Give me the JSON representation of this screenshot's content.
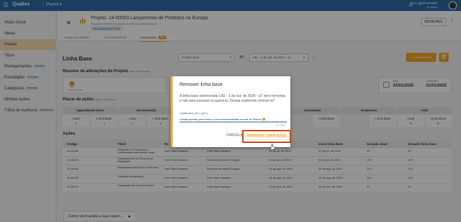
{
  "topbar": {
    "logo": "Qualiex",
    "app": "Planos",
    "user_name": "Davi | Administrador",
    "user_org": "FL EDU"
  },
  "sidebar": {
    "items": [
      {
        "label": "Visão Geral",
        "badge": ""
      },
      {
        "label": "Ideias",
        "badge": ""
      },
      {
        "label": "Planos",
        "badge": ""
      },
      {
        "label": "Tipos",
        "badge": ""
      },
      {
        "label": "Planejamentos",
        "badge": "Extensão"
      },
      {
        "label": "Estratégias",
        "badge": "Extensão"
      },
      {
        "label": "Categorias",
        "badge": "Extensão"
      },
      {
        "label": "Minhas Ações",
        "badge": ""
      },
      {
        "label": "Trilha de Auditoria",
        "badge": "Simplificada"
      }
    ]
  },
  "project": {
    "title": "Projeto: 24-00003 Lançamento de Produtos na Europa",
    "subtitle": "Programa: 00009 Expansão de Mercado Internacional",
    "status": "Em Andamento (70%)",
    "tabs": [
      "PLANO DE AÇÕES",
      "STATUS REPORT",
      "LINHA BASE",
      "Beta"
    ],
    "details_label": "DETALHES"
  },
  "linha_base": {
    "title": "Linha Base",
    "project_select": "Projeto atual",
    "lb_select": "LB2 - 1 de out. de 2024 - v2",
    "add_button": "+ LINHA BASE",
    "resumo_title": "Resumo de alterações do Projeto",
    "resumo_note": "(atual X linha base)",
    "card_value": "0",
    "card_label": "Ações novas",
    "atual_label": "Atual",
    "atual_date": "31/01/2025",
    "lb_label": "Linha Base",
    "lb_date": "31/01/2025"
  },
  "placar": {
    "title": "Placar de ações",
    "note": "(atual X linha base)",
    "columns": [
      {
        "name": "Aguardando início",
        "atual": "1",
        "linha_base": "1"
      },
      {
        "name": "Em execução",
        "atual": "1",
        "linha_base": "1"
      },
      {
        "name": "Canceladas",
        "atual": "",
        "linha_base": "Linha Base"
      },
      {
        "name": "Suspensas",
        "atual": "",
        "linha_base": "Linha Base"
      },
      {
        "name": "Total",
        "atual": "5",
        "linha_base": "5"
      }
    ],
    "sub_atual": "Atual",
    "sub_lb": "Linha Base"
  },
  "acoes": {
    "title": "Ações",
    "headers": [
      "Código",
      "Título",
      "Re",
      "Início linha Base",
      "Duração atual",
      "Duração linha base"
    ],
    "rows": [
      {
        "codigo": "24-00028",
        "titulo": "Adaptação de Produtos para Conformidade com Normas Locais",
        "resp": "Davi Silva Santana",
        "resp2": "Davi Silva Santana",
        "inicio": "01 de jul. de 2024",
        "inicio_lb": "01 de jul. de 2024",
        "dur": "30",
        "dur_lb": "30"
      },
      {
        "codigo": "24-00029",
        "titulo": "Estabelecimento de Parcerias de Distribuição",
        "resp": "Davi Silva Santana",
        "resp2": "Eleonora de Mello Gaspari",
        "inicio": "01 de jul. de 2024",
        "inicio_lb": "01 de jul. de 2024",
        "dur": "153",
        "dur_lb": "153"
      },
      {
        "codigo": "24-00043",
        "titulo": "Planejamento de Entrada no Mercado",
        "resp": "Davi Silva Santana",
        "resp2": "Eleonora de Mello Gaspari",
        "inicio": "01 de ago. de 2024",
        "inicio_lb": "01 de ago. de 2024",
        "dur": "122",
        "dur_lb": "122"
      },
      {
        "codigo": "24-00045",
        "titulo": "Estratégia de Marketing",
        "resp": "Davi Silva Santana",
        "resp2": "Davi Silva Santana",
        "inicio": "01 de ago. de 2024",
        "inicio_lb": "01 de ago. de 2024",
        "dur": "122",
        "dur_lb": "122"
      },
      {
        "codigo": "24-00071",
        "titulo": "Participação em Feiras e Eventos",
        "resp": "Davi Silva Santana",
        "resp2": "Davi Silva Santana",
        "inicio": "01 de dez. de 2024",
        "inicio_lb": "01 de dez. de 2024",
        "dur": "31",
        "dur_lb": "31"
      }
    ]
  },
  "feedback": {
    "label": "Como você avalia a sua experi..."
  },
  "modal": {
    "title": "Remover linha base",
    "body": "A linha base selecionada 'LB2 - 1 de out. de 2024 - v2' será removida e não será possível recuperá-la. Deseja realmente removê-la?",
    "just_label": "Justificativa (Por quê?)",
    "just_value": "Criada apenas para testar a nova funcionalidade incrível do Planos 🤩",
    "char_count": "65 / 4000",
    "cancel": "CANCELAR",
    "remove": "REMOVER LINHA BASE"
  },
  "colors": {
    "primary": "#2e6ca5",
    "accent": "#f1a63c",
    "danger_outline": "#c94a1b"
  }
}
